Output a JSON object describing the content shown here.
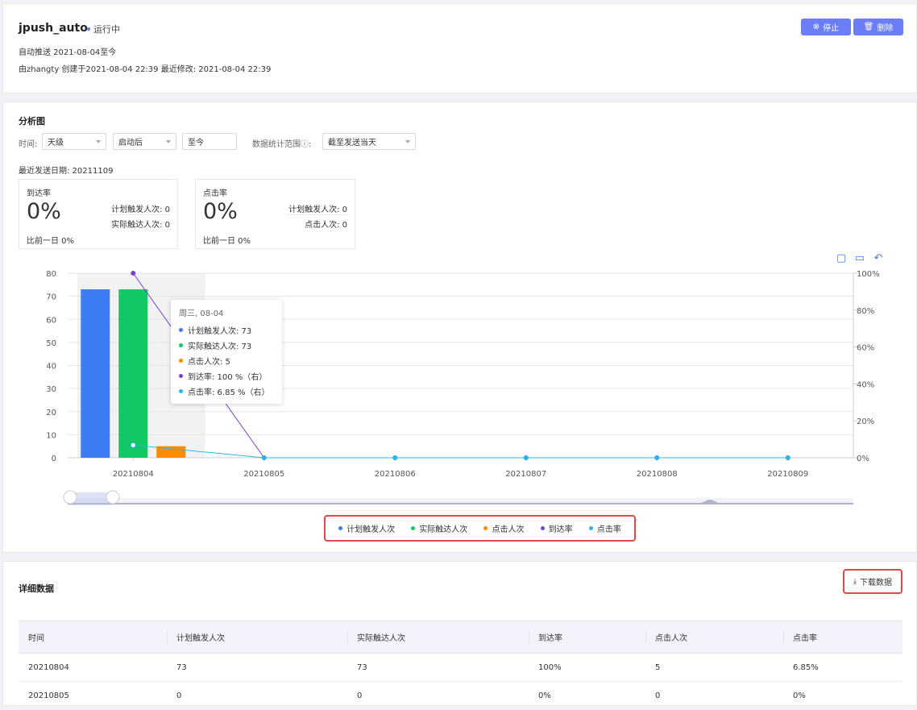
{
  "header": {
    "title": "jpush_auto",
    "status": "运行中",
    "schedule": "自动推送  2021-08-04至今",
    "meta": "由zhangty 创建于2021-08-04 22:39 最近修改: 2021-08-04 22:39",
    "stop_label": "停止",
    "delete_label": "删除"
  },
  "analysis": {
    "title": "分析图",
    "time_label": "时间:",
    "granularity": "天级",
    "start": "启动后",
    "end": "至今",
    "range_label": "数据统计范围ⓘ:",
    "range_value": "截至发送当天",
    "last_send": "最近发送日期: 20211109",
    "metrics": [
      {
        "title": "到达率",
        "value": "0%",
        "compare": "比前一日 0%",
        "sub1": "计划触发人次: 0",
        "sub2": "实际触达人次: 0"
      },
      {
        "title": "点击率",
        "value": "0%",
        "compare": "比前一日 0%",
        "sub1": "计划触发人次: 0",
        "sub2": "点击人次: 0"
      }
    ],
    "toolbar_icons": [
      "zoom-area-icon",
      "zoom-reset-icon",
      "restore-icon"
    ]
  },
  "chart_data": {
    "type": "bar",
    "categories": [
      "20210804",
      "20210805",
      "20210806",
      "20210807",
      "20210808",
      "20210809"
    ],
    "series": [
      {
        "name": "计划触发人次",
        "kind": "bar",
        "axis": "left",
        "color": "#3c7df5",
        "values": [
          73,
          0,
          0,
          0,
          0,
          0
        ]
      },
      {
        "name": "实际触达人次",
        "kind": "bar",
        "axis": "left",
        "color": "#12c865",
        "values": [
          73,
          0,
          0,
          0,
          0,
          0
        ]
      },
      {
        "name": "点击人次",
        "kind": "bar",
        "axis": "left",
        "color": "#fb8c00",
        "values": [
          5,
          0,
          0,
          0,
          0,
          0
        ]
      },
      {
        "name": "到达率",
        "kind": "line",
        "axis": "right",
        "color": "#7741d6",
        "values": [
          100,
          0,
          0,
          0,
          0,
          0
        ]
      },
      {
        "name": "点击率",
        "kind": "line",
        "axis": "right",
        "color": "#2bb5ec",
        "values": [
          6.85,
          0,
          0,
          0,
          0,
          0
        ]
      }
    ],
    "y_left": {
      "ticks": [
        "0",
        "10",
        "20",
        "30",
        "40",
        "50",
        "60",
        "70",
        "80"
      ],
      "range": [
        0,
        80
      ]
    },
    "y_right": {
      "ticks": [
        "0%",
        "20%",
        "40%",
        "60%",
        "80%",
        "100%"
      ],
      "range": [
        0,
        100
      ]
    },
    "grid": true,
    "legend": "bottom-center",
    "tooltip": {
      "title": "周三, 08-04",
      "rows": [
        "计划触发人次:  73",
        "实际触达人次:  73",
        "点击人次:  5",
        "到达率:  100 %（右）",
        "点击率:  6.85 %（右）"
      ]
    }
  },
  "detail": {
    "title": "详细数据",
    "download_label": "下载数据",
    "columns": [
      "时间",
      "计划触发人次",
      "实际触达人次",
      "到达率",
      "点击人次",
      "点击率"
    ],
    "rows": [
      [
        "20210804",
        "73",
        "73",
        "100%",
        "5",
        "6.85%"
      ],
      [
        "20210805",
        "0",
        "0",
        "0%",
        "0",
        "0%"
      ]
    ]
  }
}
